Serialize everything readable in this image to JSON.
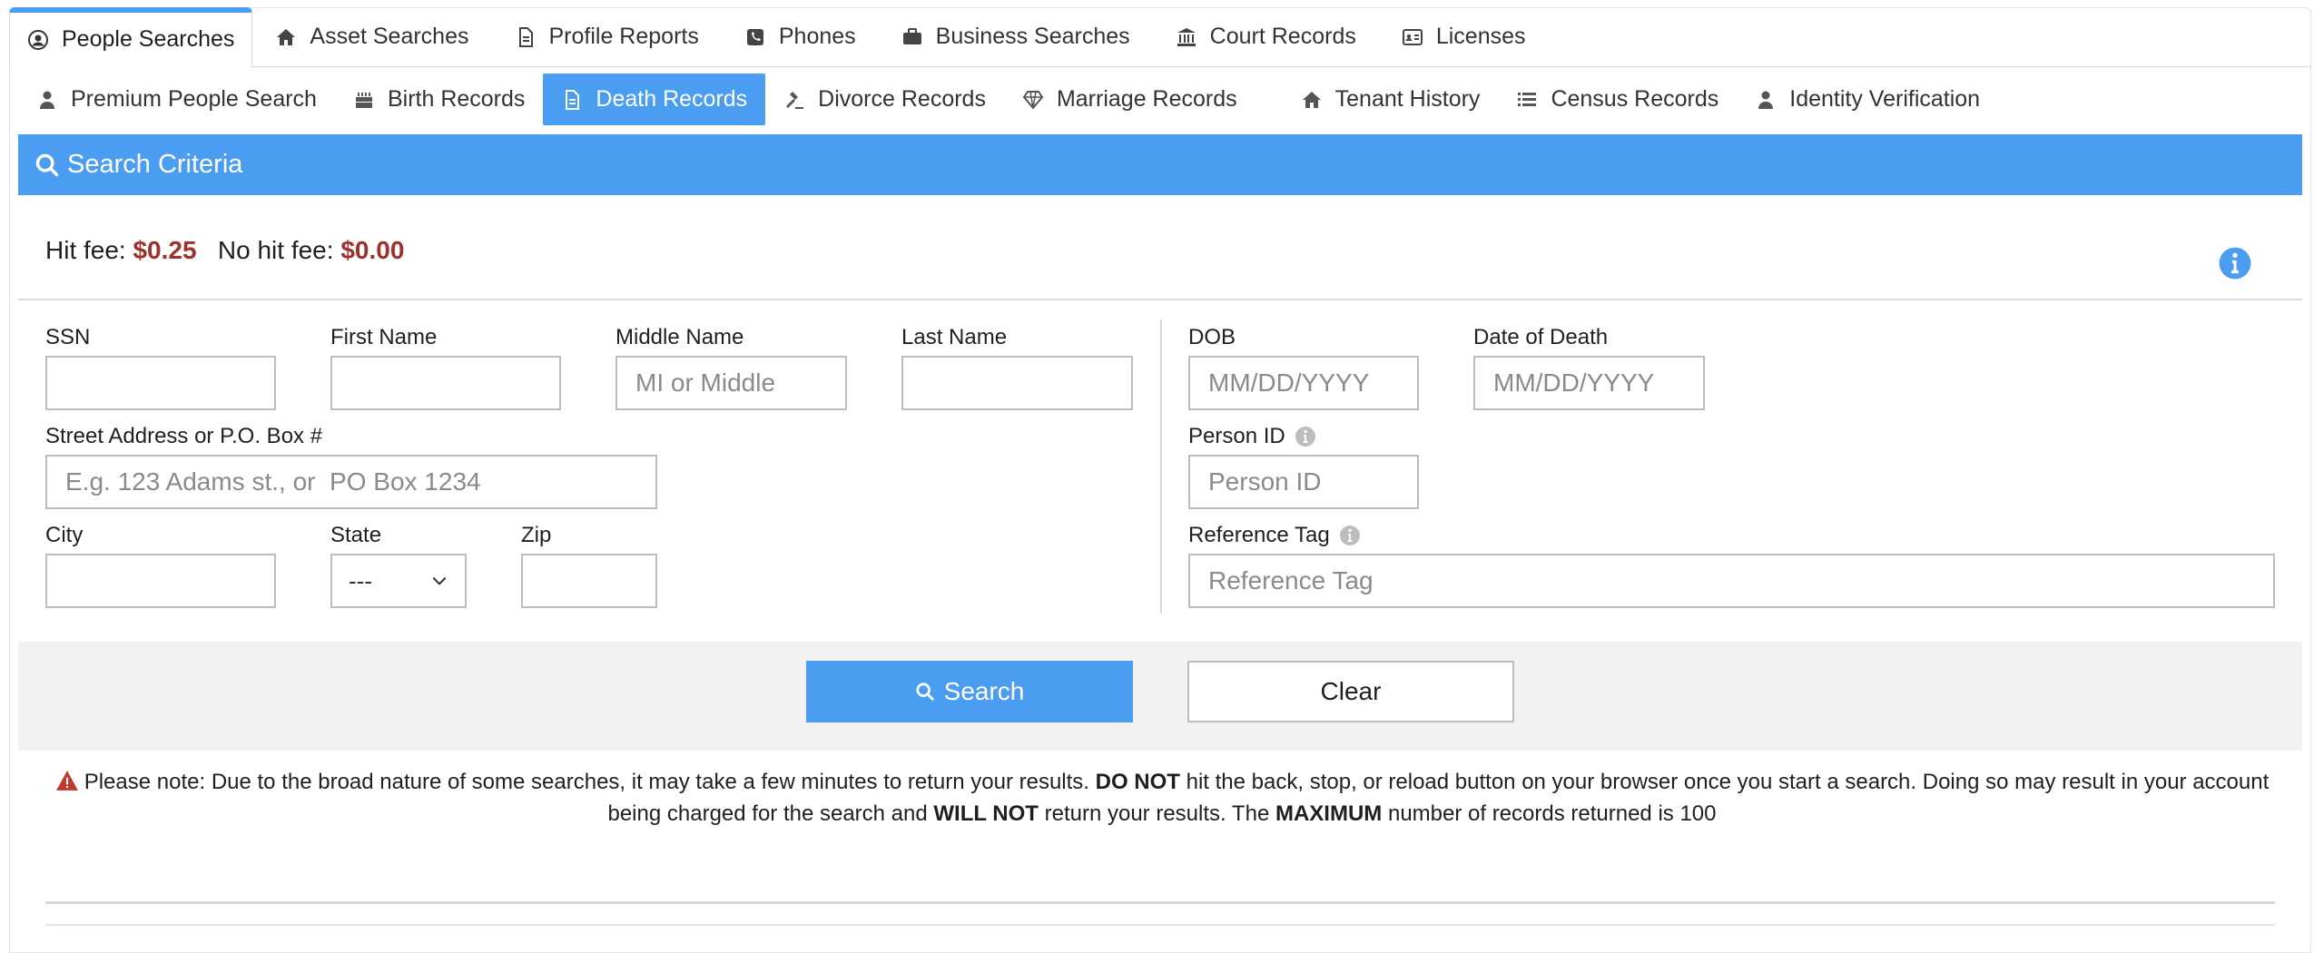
{
  "top_tabs": [
    {
      "label": "People Searches",
      "icon": "user-circle-icon",
      "active": true
    },
    {
      "label": "Asset Searches",
      "icon": "home-icon"
    },
    {
      "label": "Profile Reports",
      "icon": "document-icon"
    },
    {
      "label": "Phones",
      "icon": "phone-icon"
    },
    {
      "label": "Business Searches",
      "icon": "briefcase-icon"
    },
    {
      "label": "Court Records",
      "icon": "courthouse-icon"
    },
    {
      "label": "Licenses",
      "icon": "id-card-icon"
    }
  ],
  "sub_tabs": [
    {
      "label": "Premium People Search",
      "icon": "user-icon"
    },
    {
      "label": "Birth Records",
      "icon": "birthday-cake-icon"
    },
    {
      "label": "Death Records",
      "icon": "document-icon",
      "active": true
    },
    {
      "label": "Divorce Records",
      "icon": "gavel-icon"
    },
    {
      "label": "Marriage Records",
      "icon": "diamond-icon"
    },
    {
      "label": "Tenant History",
      "icon": "home-icon"
    },
    {
      "label": "Census Records",
      "icon": "list-icon"
    },
    {
      "label": "Identity Verification",
      "icon": "user-icon"
    }
  ],
  "criteria": {
    "title": "Search Criteria"
  },
  "fees": {
    "hit_label": "Hit fee:",
    "hit_value": "$0.25",
    "nohit_label": "No hit fee:",
    "nohit_value": "$0.00"
  },
  "form": {
    "ssn": {
      "label": "SSN",
      "value": "",
      "placeholder": ""
    },
    "first_name": {
      "label": "First Name",
      "value": "",
      "placeholder": ""
    },
    "middle_name": {
      "label": "Middle Name",
      "value": "",
      "placeholder": "MI or Middle"
    },
    "last_name": {
      "label": "Last Name",
      "value": "",
      "placeholder": ""
    },
    "dob": {
      "label": "DOB",
      "value": "",
      "placeholder": "MM/DD/YYYY"
    },
    "date_of_death": {
      "label": "Date of Death",
      "value": "",
      "placeholder": "MM/DD/YYYY"
    },
    "street": {
      "label": "Street Address or P.O. Box #",
      "value": "",
      "placeholder": "E.g. 123 Adams st., or  PO Box 1234"
    },
    "person_id": {
      "label": "Person ID",
      "value": "",
      "placeholder": "Person ID"
    },
    "city": {
      "label": "City",
      "value": "",
      "placeholder": ""
    },
    "state": {
      "label": "State",
      "selected": "---"
    },
    "zip": {
      "label": "Zip",
      "value": "",
      "placeholder": ""
    },
    "reference_tag": {
      "label": "Reference Tag",
      "value": "",
      "placeholder": "Reference Tag"
    }
  },
  "buttons": {
    "search": "Search",
    "clear": "Clear"
  },
  "note": {
    "p1": "Please note: Due to the broad nature of some searches, it may take a few minutes to return your results.",
    "b1": "DO NOT",
    "p2": "hit the back, stop, or reload button on your browser once you start a search. Doing so may result in your account being charged for the search and",
    "b2": "WILL NOT",
    "p3": "return your results. The",
    "b3": "MAXIMUM",
    "p4": "number of records returned is 100"
  },
  "colors": {
    "accent": "#4a9df0",
    "fee": "#a0302c",
    "warning": "#c0392b"
  }
}
